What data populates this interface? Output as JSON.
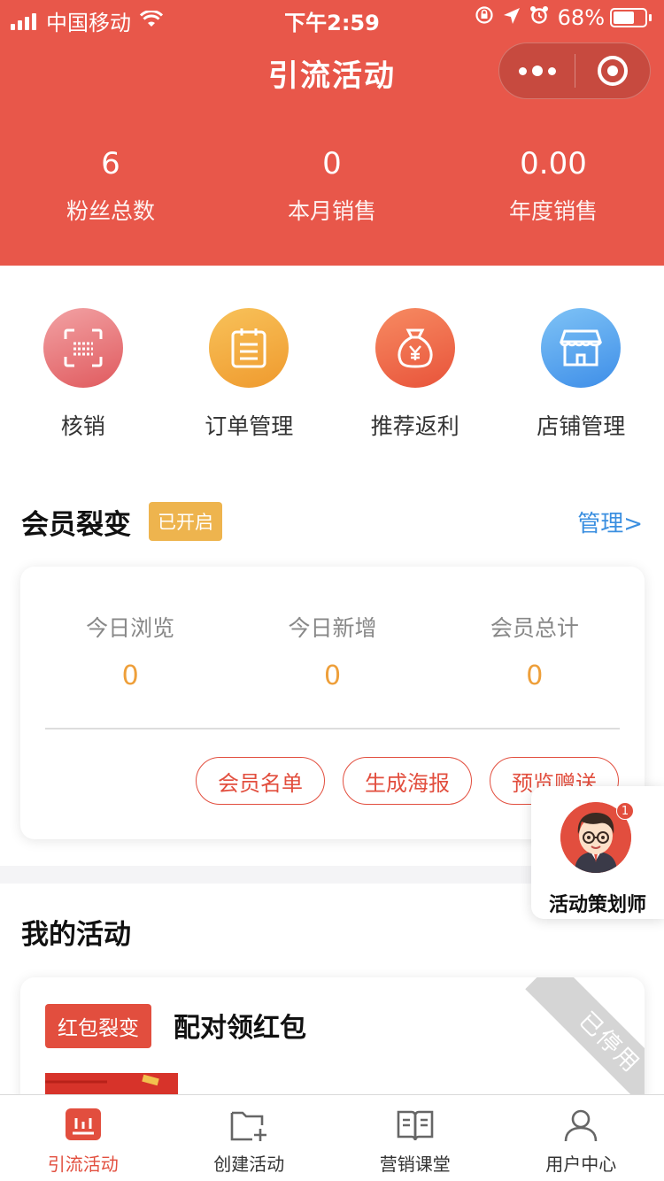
{
  "status_bar": {
    "carrier": "中国移动",
    "time": "下午2:59",
    "battery": "68%",
    "battery_level": 0.68
  },
  "nav": {
    "title": "引流活动"
  },
  "stats": [
    {
      "value": "6",
      "label": "粉丝总数"
    },
    {
      "value": "0",
      "label": "本月销售"
    },
    {
      "value": "0.00",
      "label": "年度销售"
    }
  ],
  "quick_menu": [
    {
      "label": "核销",
      "icon": "scan-icon",
      "color_from": "#F2A2A4",
      "color_to": "#E05A5E"
    },
    {
      "label": "订单管理",
      "icon": "clipboard-icon",
      "color_from": "#F8C25A",
      "color_to": "#EF9A2E"
    },
    {
      "label": "推荐返利",
      "icon": "money-bag-icon",
      "color_from": "#F78B62",
      "color_to": "#E8533A"
    },
    {
      "label": "店铺管理",
      "icon": "store-icon",
      "color_from": "#7FC3F6",
      "color_to": "#3E8EE8"
    }
  ],
  "member": {
    "title": "会员裂变",
    "status_badge": "已开启",
    "manage_link": "管理>",
    "stats": [
      {
        "label": "今日浏览",
        "value": "0"
      },
      {
        "label": "今日新增",
        "value": "0"
      },
      {
        "label": "会员总计",
        "value": "0"
      }
    ],
    "buttons": [
      "会员名单",
      "生成海报",
      "预览赠送"
    ]
  },
  "planner": {
    "label": "活动策划师",
    "badge_count": "1"
  },
  "activities": {
    "title": "我的活动",
    "items": [
      {
        "tag": "红包裂变",
        "name": "配对领红包",
        "status": "已停用"
      }
    ]
  },
  "tabbar": [
    {
      "label": "引流活动",
      "icon": "chart-icon",
      "active": true
    },
    {
      "label": "创建活动",
      "icon": "add-folder-icon",
      "active": false
    },
    {
      "label": "营销课堂",
      "icon": "book-icon",
      "active": false
    },
    {
      "label": "用户中心",
      "icon": "user-icon",
      "active": false
    }
  ],
  "colors": {
    "brand_red": "#E8574A",
    "accent_red": "#E24E3E",
    "link_blue": "#3B8FE0",
    "badge_yellow": "#EEB44E",
    "value_orange": "#EE9F3A"
  }
}
